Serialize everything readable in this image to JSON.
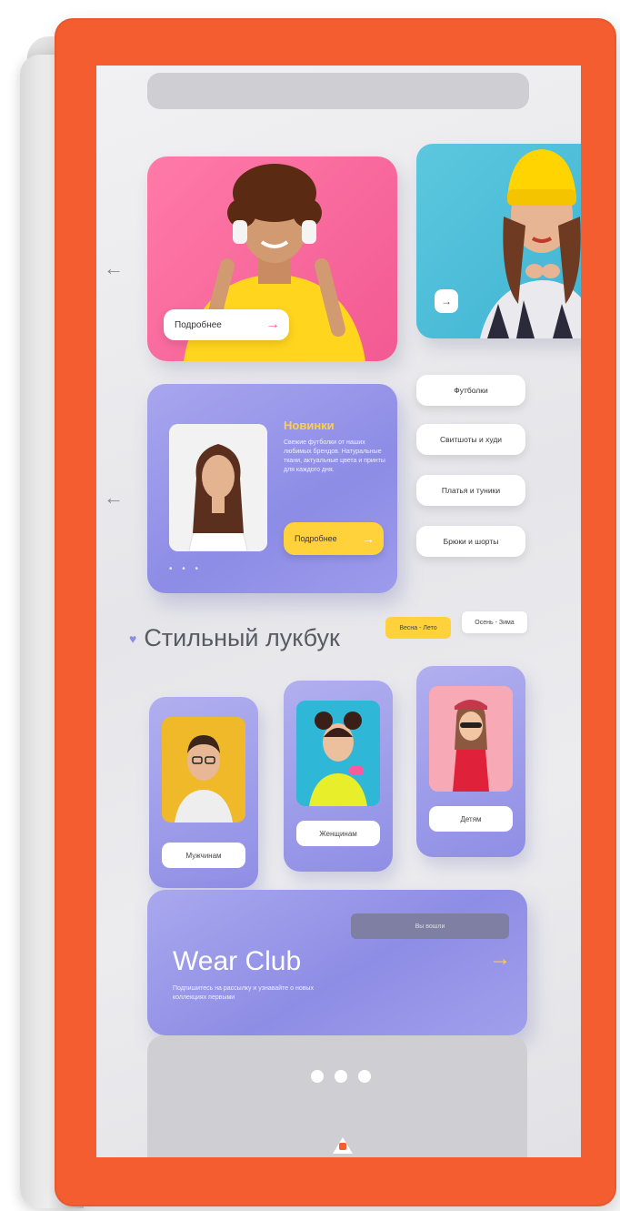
{
  "promo": {
    "details_label": "Подробнее",
    "small_btn_icon": "arrow-right-icon"
  },
  "feature": {
    "title": "Новинки",
    "text": "Свежие футболки от наших любимых брендов. Натуральные ткани, актуальные цвета и принты для каждого дня.",
    "button_label": "Подробнее",
    "dots": "• • •"
  },
  "categories": [
    {
      "label": "Футболки"
    },
    {
      "label": "Свитшоты и худи"
    },
    {
      "label": "Платья и туники"
    },
    {
      "label": "Брюки и шорты"
    }
  ],
  "lookbook": {
    "title": "Стильный лукбук",
    "tag_primary": "Весна - Лето",
    "tag_secondary": "Осень - Зима",
    "cards": [
      {
        "label": "Мужчинам"
      },
      {
        "label": "Женщинам"
      },
      {
        "label": "Детям"
      }
    ]
  },
  "club": {
    "name": "Wear Club",
    "description": "Подпишитесь на рассылку и узнавайте о новых коллекциях первыми",
    "button_label": "Вы вошли"
  },
  "colors": {
    "frame": "#f45d2f",
    "accent_purple": "#8d8ce6",
    "accent_yellow": "#ffd23c",
    "accent_pink": "#f25a92",
    "accent_blue": "#3fb3d3"
  }
}
